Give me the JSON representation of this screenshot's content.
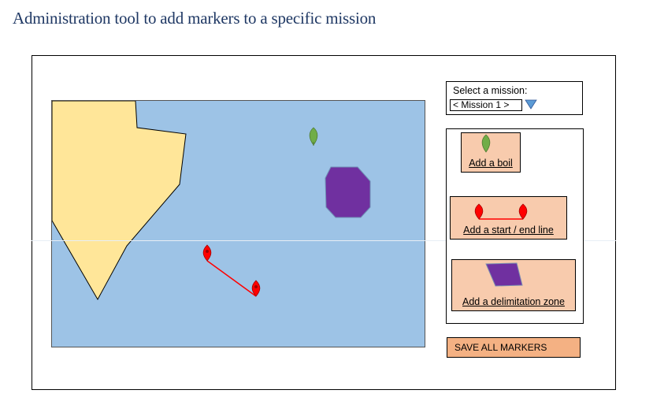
{
  "page": {
    "title": "Administration tool to add markers to a specific mission"
  },
  "mission_selector": {
    "label": "Select a mission:",
    "selected": "< Mission 1 >"
  },
  "tools": {
    "add_buoy_label": "Add a boil",
    "add_line_label": "Add a start / end line",
    "add_zone_label": "Add a delimitation zone"
  },
  "actions": {
    "save_label": "SAVE ALL MARKERS"
  },
  "map": {
    "water_color": "#9dc3e6",
    "land_color": "#ffe699",
    "zone_color": "#7030a0",
    "buoy_color": "#70ad47",
    "line_marker_color": "#ff0000"
  },
  "colors": {
    "title": "#1f3864",
    "tool_button_bg": "#f8cbad",
    "save_button_bg": "#f4b183",
    "dropdown_arrow": "#5b9bd5"
  },
  "icons": {
    "dropdown": "triangle-down-icon",
    "buoy": "map-pin-icon",
    "line_endpoint": "map-pin-icon",
    "zone": "polygon-icon"
  }
}
